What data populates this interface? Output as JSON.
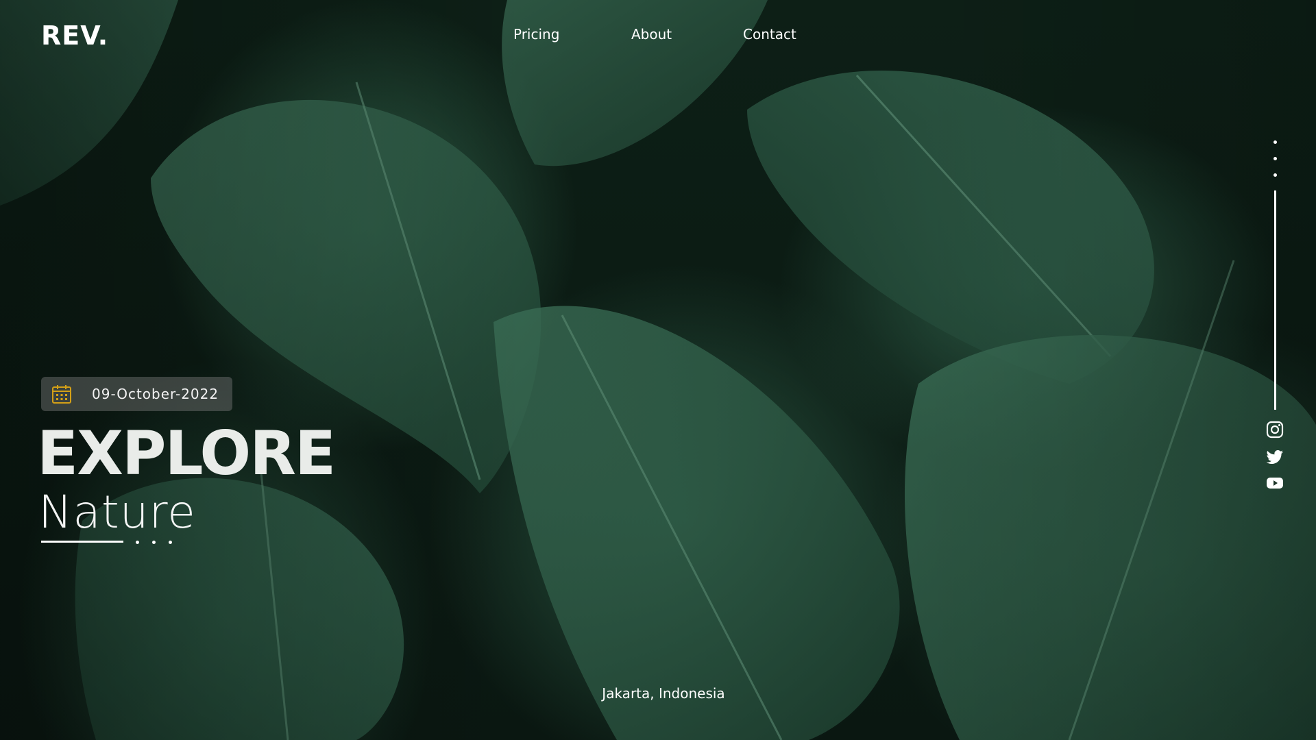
{
  "brand": {
    "logo": "REV."
  },
  "nav": {
    "items": [
      {
        "label": "Pricing"
      },
      {
        "label": "About"
      },
      {
        "label": "Contact"
      }
    ]
  },
  "hero": {
    "date": "09-October-2022",
    "date_icon": "calendar-icon",
    "title": "EXPLORE",
    "subtitle": "Nature",
    "slide_indicator": {
      "active_index": 0,
      "total": 4
    }
  },
  "side_rail": {
    "dots": 3,
    "social": [
      {
        "icon": "instagram-icon"
      },
      {
        "icon": "twitter-icon"
      },
      {
        "icon": "youtube-icon"
      }
    ]
  },
  "footer": {
    "location": "Jakarta, Indonesia"
  },
  "colors": {
    "accent": "#d4a017",
    "text": "#ffffff",
    "foliage": "#2c5a45",
    "badge_bg": "#787878"
  }
}
